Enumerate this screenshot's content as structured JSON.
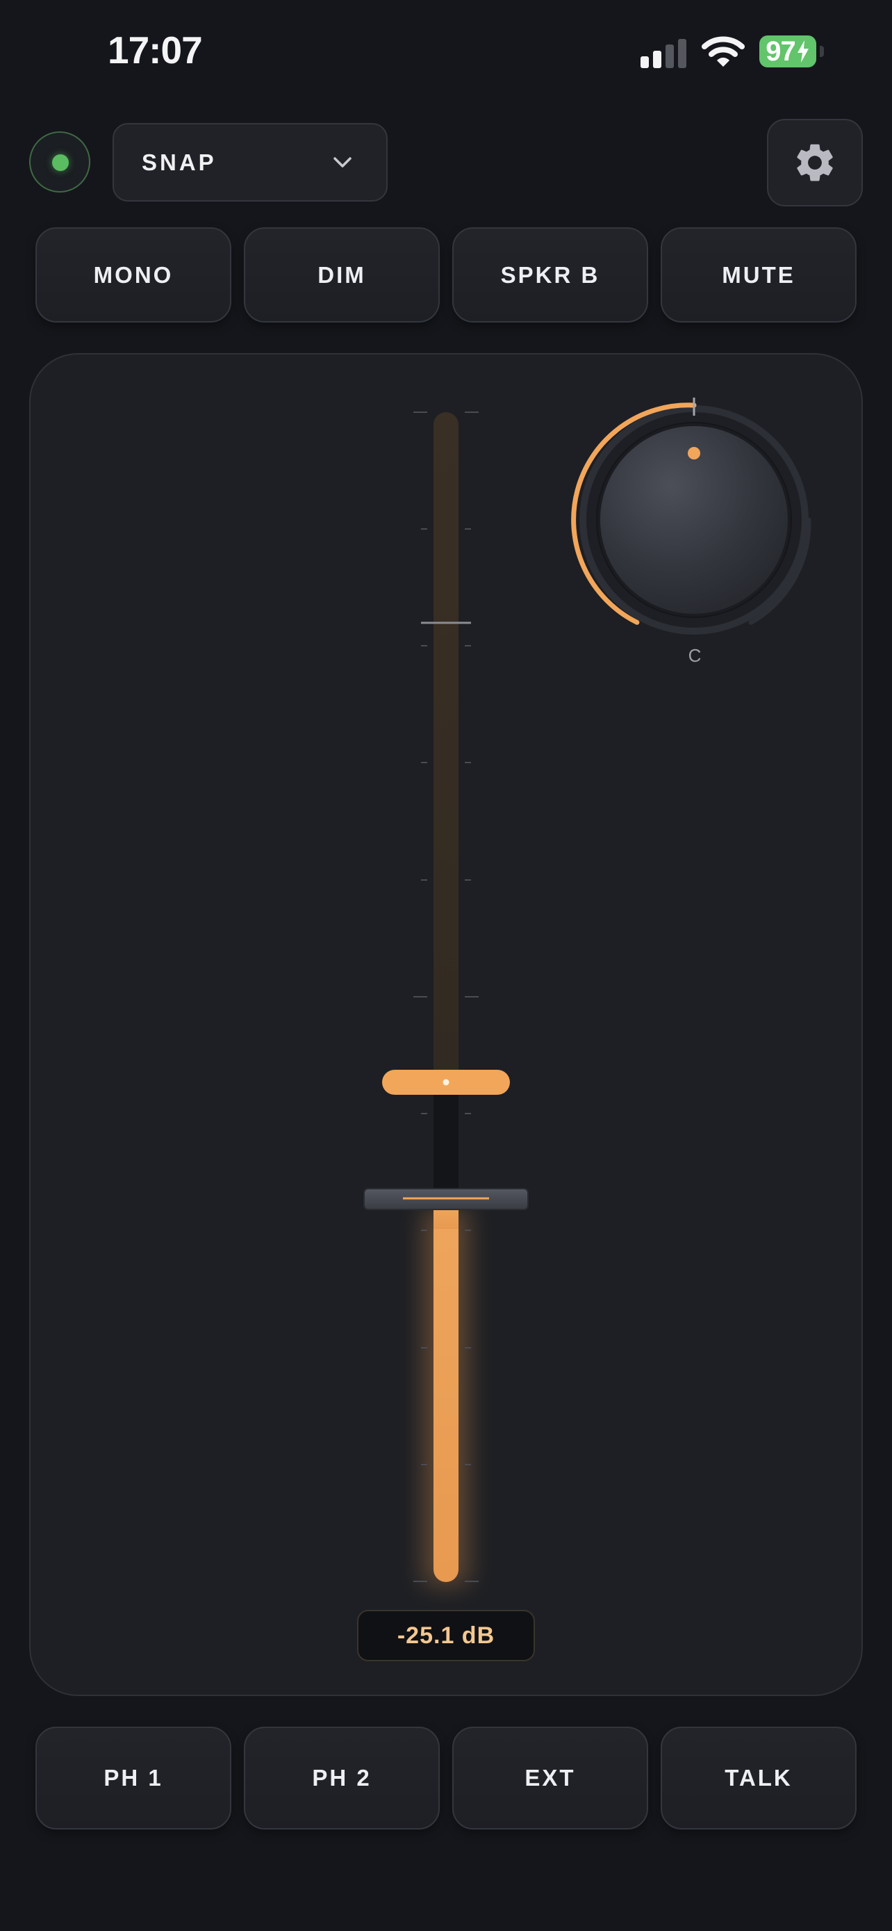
{
  "status_bar": {
    "time": "17:07",
    "battery": "97",
    "battery_state": "charging",
    "icons": [
      "cellular-signal-icon",
      "wifi-icon",
      "battery-charging-icon"
    ]
  },
  "header": {
    "connection_status": "connected",
    "preset": {
      "label": "SNAP"
    },
    "settings_icon": "gear-icon"
  },
  "monitor_buttons": [
    {
      "label": "MONO"
    },
    {
      "label": "DIM"
    },
    {
      "label": "SPKR B"
    },
    {
      "label": "MUTE"
    }
  ],
  "fader": {
    "readout": "-25.1 dB",
    "level_fraction": 0.34,
    "marker_fraction": 0.43
  },
  "pan_knob": {
    "label": "C",
    "position": "center"
  },
  "source_buttons": [
    {
      "label": "PH 1"
    },
    {
      "label": "PH 2"
    },
    {
      "label": "EXT"
    },
    {
      "label": "TALK"
    }
  ],
  "colors": {
    "accent": "#f2a65a",
    "status_green": "#5bbd62",
    "background": "#15161b",
    "panel": "#1d1f24"
  }
}
